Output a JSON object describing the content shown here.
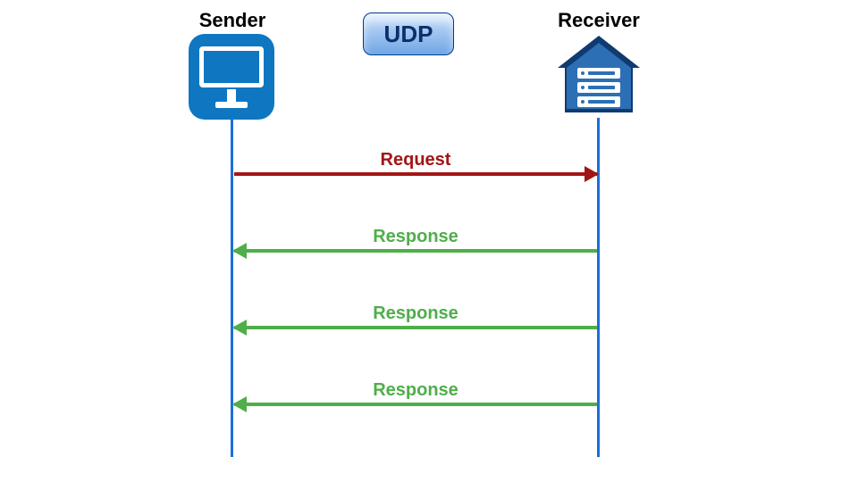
{
  "protocol_label": "UDP",
  "sender": {
    "label": "Sender"
  },
  "receiver": {
    "label": "Receiver"
  },
  "messages": {
    "request": {
      "label": "Request",
      "direction": "right",
      "color": "#a31515"
    },
    "response1": {
      "label": "Response",
      "direction": "left",
      "color": "#4fae4a"
    },
    "response2": {
      "label": "Response",
      "direction": "left",
      "color": "#4fae4a"
    },
    "response3": {
      "label": "Response",
      "direction": "left",
      "color": "#4fae4a"
    }
  },
  "colors": {
    "lifeline": "#1c6fd8",
    "sender_icon_bg": "#0f77c2",
    "receiver_icon_dark": "#103a70",
    "receiver_icon_light": "#2c6fb5"
  }
}
